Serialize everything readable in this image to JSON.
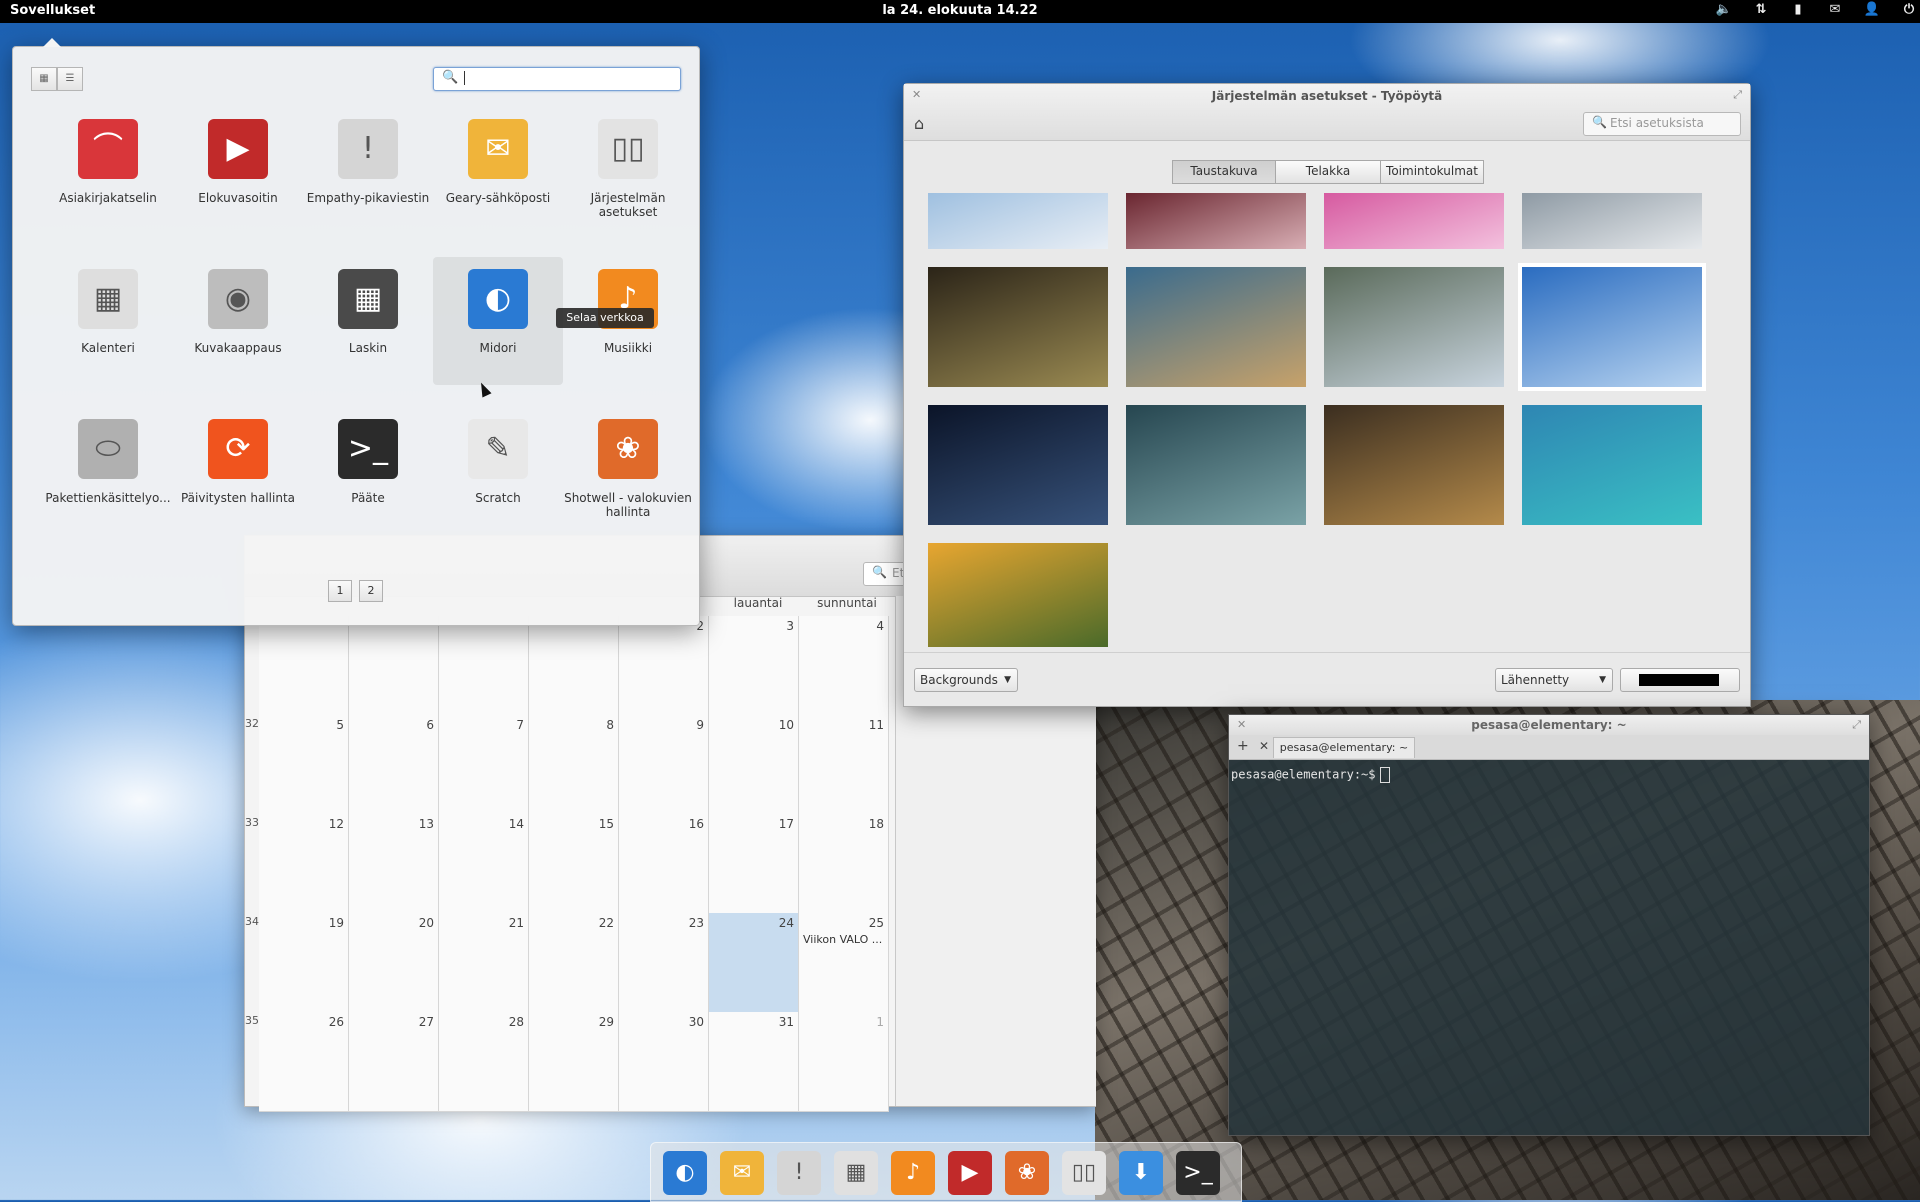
{
  "panel": {
    "apps_label": "Sovellukset",
    "clock": "la 24. elokuuta 14.22",
    "indicators": [
      {
        "name": "sound-icon",
        "glyph": "🔈"
      },
      {
        "name": "network-icon",
        "glyph": "⇅"
      },
      {
        "name": "battery-icon",
        "glyph": "▮"
      },
      {
        "name": "mail-icon",
        "glyph": "✉"
      },
      {
        "name": "user-icon",
        "glyph": "👤"
      },
      {
        "name": "power-icon",
        "glyph": "⏻"
      }
    ]
  },
  "launcher": {
    "search_value": "",
    "apps": [
      {
        "name": "Asiakirjakatselin",
        "color": "#d9363a",
        "glyph": "⌒"
      },
      {
        "name": "Elokuvasoitin",
        "color": "#c12a2a",
        "glyph": "▶"
      },
      {
        "name": "Empathy-pikaviestin",
        "color": "#d5d5d5",
        "glyph": "!"
      },
      {
        "name": "Geary-sähköposti",
        "color": "#f0b43a",
        "glyph": "✉"
      },
      {
        "name": "Järjestelmän asetukset",
        "color": "#e3e3e3",
        "glyph": "▯▯"
      },
      {
        "name": "Kalenteri",
        "color": "#dedede",
        "glyph": "▦"
      },
      {
        "name": "Kuvakaappaus",
        "color": "#bdbdbd",
        "glyph": "◉"
      },
      {
        "name": "Laskin",
        "color": "#4a4a4a",
        "glyph": "▦"
      },
      {
        "name": "Midori",
        "color": "#2a7ad3",
        "glyph": "◐"
      },
      {
        "name": "Musiikki",
        "color": "#f28a1f",
        "glyph": "♪"
      },
      {
        "name": "Pakettienkäsittelyo...",
        "color": "#b0b0b0",
        "glyph": "⬭"
      },
      {
        "name": "Päivitysten hallinta",
        "color": "#f0541e",
        "glyph": "⟳"
      },
      {
        "name": "Pääte",
        "color": "#2b2b2b",
        "glyph": ">_"
      },
      {
        "name": "Scratch",
        "color": "#e8e8e8",
        "glyph": "✎"
      },
      {
        "name": "Shotwell - valokuvien hallinta",
        "color": "#e06a2a",
        "glyph": "❀"
      }
    ],
    "tooltip": "Selaa verkkoa",
    "pages": [
      "1",
      "2"
    ]
  },
  "settings": {
    "title": "Järjestelmän asetukset - Työpöytä",
    "search_placeholder": "Etsi asetuksista",
    "tabs": [
      "Taustakuva",
      "Telakka",
      "Toimintokulmat"
    ],
    "active_tab": "Taustakuva",
    "wallpapers": [
      {
        "name": "clouds",
        "colors": [
          "#9fc0e0",
          "#e8eef5"
        ]
      },
      {
        "name": "red-leaves",
        "colors": [
          "#6a2630",
          "#d8aeb4"
        ]
      },
      {
        "name": "lotus",
        "colors": [
          "#d65aa0",
          "#f3c1de"
        ]
      },
      {
        "name": "light-rays",
        "colors": [
          "#8e9aa4",
          "#e6e9ec"
        ]
      },
      {
        "name": "tunnel",
        "colors": [
          "#2b2418",
          "#9a8a52"
        ]
      },
      {
        "name": "coast",
        "colors": [
          "#3a6b8d",
          "#c7a26a"
        ]
      },
      {
        "name": "mountains",
        "colors": [
          "#5a6a5a",
          "#c8d4de"
        ]
      },
      {
        "name": "eiffel",
        "colors": [
          "#2a6cc0",
          "#b7d3f0"
        ]
      },
      {
        "name": "night-sky",
        "colors": [
          "#0b1428",
          "#37527a"
        ]
      },
      {
        "name": "lighthouse",
        "colors": [
          "#264650",
          "#7aa2a6"
        ]
      },
      {
        "name": "autumn-leaves",
        "colors": [
          "#3b2e20",
          "#b48a4a"
        ]
      },
      {
        "name": "lake",
        "colors": [
          "#2e86b3",
          "#3ac0c4"
        ]
      },
      {
        "name": "sunset-field",
        "colors": [
          "#e8a630",
          "#4a6a2a"
        ]
      }
    ],
    "selected_wallpaper": "eiffel",
    "folder_select": "Backgrounds",
    "mode_select": "Lähennetty",
    "color_value": "#000000"
  },
  "calendar": {
    "search_partial": "Et",
    "day_headers": [
      "lauantai",
      "sunnuntai"
    ],
    "week_numbers": [
      "32",
      "33",
      "34",
      "35"
    ],
    "rows": [
      [
        "",
        "",
        "",
        "",
        "2",
        "3",
        "4"
      ],
      [
        "5",
        "6",
        "7",
        "8",
        "9",
        "10",
        "11"
      ],
      [
        "12",
        "13",
        "14",
        "15",
        "16",
        "17",
        "18"
      ],
      [
        "19",
        "20",
        "21",
        "22",
        "23",
        "24",
        "25"
      ],
      [
        "26",
        "27",
        "28",
        "29",
        "30",
        "31",
        "1"
      ]
    ],
    "today": "24",
    "event": {
      "day": "25",
      "text": "Viikon VALO ..."
    }
  },
  "terminal": {
    "title": "pesasa@elementary: ~",
    "tab_label": "pesasa@elementary: ~",
    "prompt": "pesasa@elementary:~$"
  },
  "dock": {
    "items": [
      {
        "name": "midori",
        "color": "#2a7ad3",
        "glyph": "◐"
      },
      {
        "name": "mail",
        "color": "#f0b43a",
        "glyph": "✉"
      },
      {
        "name": "empathy",
        "color": "#d5d5d5",
        "glyph": "!"
      },
      {
        "name": "calendar",
        "color": "#e0e0e0",
        "glyph": "▦"
      },
      {
        "name": "music",
        "color": "#f28a1f",
        "glyph": "♪"
      },
      {
        "name": "video",
        "color": "#c12a2a",
        "glyph": "▶"
      },
      {
        "name": "shotwell",
        "color": "#e06a2a",
        "glyph": "❀"
      },
      {
        "name": "settings",
        "color": "#e3e3e3",
        "glyph": "▯▯"
      },
      {
        "name": "downloads",
        "color": "#3b8fe0",
        "glyph": "⬇"
      },
      {
        "name": "terminal",
        "color": "#2b2b2b",
        "glyph": ">_"
      }
    ]
  }
}
